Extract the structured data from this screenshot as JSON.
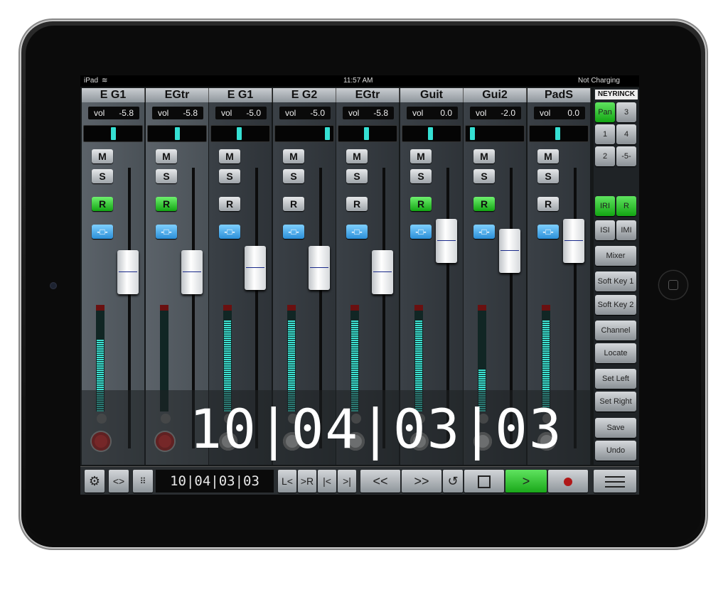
{
  "status_bar": {
    "device": "iPad",
    "time": "11:57 AM",
    "battery": "Not Charging"
  },
  "brand": "NEYRINCK",
  "channels": [
    {
      "name": "E G1",
      "vol_label": "vol",
      "vol": "-5.8",
      "mute": "M",
      "solo": "S",
      "rec": "R",
      "rec_armed": true
    },
    {
      "name": "EGtr",
      "vol_label": "vol",
      "vol": "-5.8",
      "mute": "M",
      "solo": "S",
      "rec": "R",
      "rec_armed": true
    },
    {
      "name": "E G1",
      "vol_label": "vol",
      "vol": "-5.0",
      "mute": "M",
      "solo": "S",
      "rec": "R",
      "rec_armed": false
    },
    {
      "name": "E G2",
      "vol_label": "vol",
      "vol": "-5.0",
      "mute": "M",
      "solo": "S",
      "rec": "R",
      "rec_armed": false
    },
    {
      "name": "EGtr",
      "vol_label": "vol",
      "vol": "-5.8",
      "mute": "M",
      "solo": "S",
      "rec": "R",
      "rec_armed": false
    },
    {
      "name": "Guit",
      "vol_label": "vol",
      "vol": "0.0",
      "mute": "M",
      "solo": "S",
      "rec": "R",
      "rec_armed": true
    },
    {
      "name": "Gui2",
      "vol_label": "vol",
      "vol": "-2.0",
      "mute": "M",
      "solo": "S",
      "rec": "R",
      "rec_armed": true
    },
    {
      "name": "PadS",
      "vol_label": "vol",
      "vol": "0.0",
      "mute": "M",
      "solo": "S",
      "rec": "R",
      "rec_armed": false
    }
  ],
  "big_time": "10|04|03|03",
  "side_panel": {
    "mode_buttons": [
      "Pan",
      "3",
      "1",
      "4",
      "2",
      "-5-"
    ],
    "toggle_buttons": [
      "IRI",
      "R",
      "ISI",
      "IMI"
    ],
    "function_buttons": [
      "Mixer",
      "Soft Key 1",
      "Soft Key 2",
      "Channel",
      "Locate",
      "Set Left",
      "Set Right",
      "Save",
      "Undo"
    ]
  },
  "transport": {
    "settings_icon": "gear-icon",
    "swap_label": "<>",
    "keypad_icon": "keypad-icon",
    "time": "10|04|03|03",
    "locate_left": "L<",
    "locate_right": ">R",
    "to_start": "|<",
    "to_end": ">|",
    "rewind": "<<",
    "forward": ">>",
    "cycle_icon": "loop-icon",
    "stop_icon": "stop-icon",
    "play": ">",
    "record_icon": "record-icon",
    "menu_icon": "menu-icon"
  }
}
